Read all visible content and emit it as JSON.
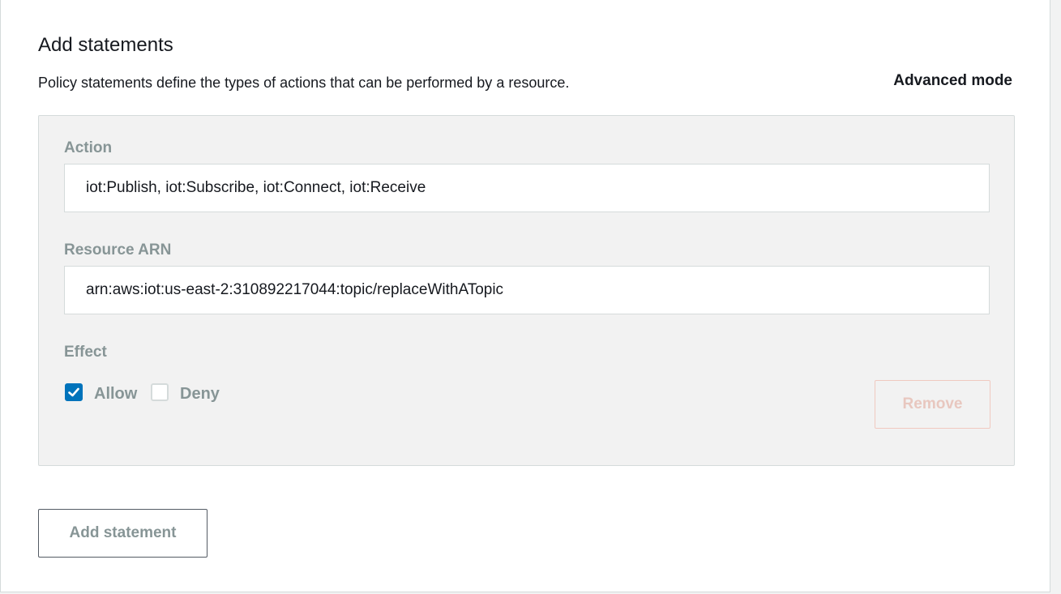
{
  "section": {
    "title": "Add statements",
    "description": "Policy statements define the types of actions that can be performed by a resource.",
    "advanced_mode_label": "Advanced mode"
  },
  "statement": {
    "action_label": "Action",
    "action_value": "iot:Publish, iot:Subscribe, iot:Connect, iot:Receive",
    "resource_label": "Resource ARN",
    "resource_value": "arn:aws:iot:us-east-2:310892217044:topic/replaceWithATopic",
    "effect_label": "Effect",
    "effect_options": [
      {
        "label": "Allow",
        "checked": true
      },
      {
        "label": "Deny",
        "checked": false
      }
    ],
    "remove_label": "Remove"
  },
  "add_statement_label": "Add statement",
  "colors": {
    "accent": "#0073bb",
    "remove_disabled": "#e8c7bf"
  },
  "icons": {
    "checkmark": "checkmark-icon"
  }
}
